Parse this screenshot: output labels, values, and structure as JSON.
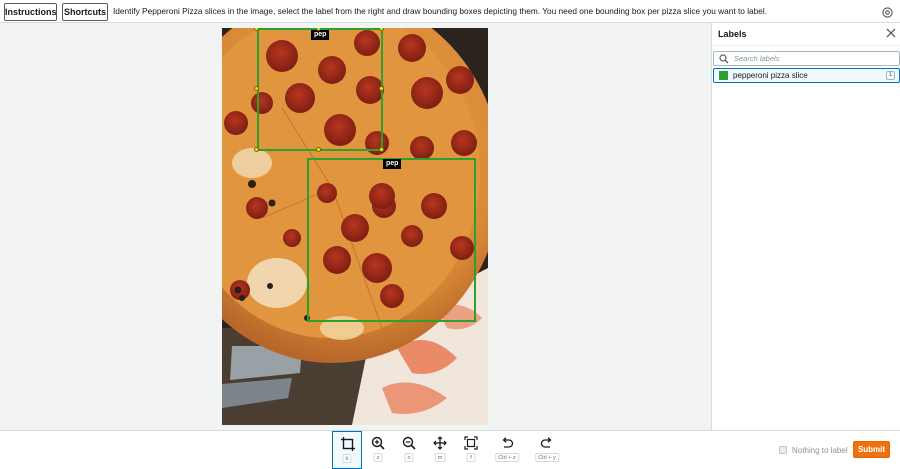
{
  "topbar": {
    "instructions_label": "Instructions",
    "shortcuts_label": "Shortcuts",
    "task_text": "Identify Pepperoni Pizza slices in the image, select the label from the right and draw bounding boxes depicting them. You need one bounding box per pizza slice you want to label.",
    "help_icon": "help-circle-icon"
  },
  "canvas": {
    "image_subject": "pepperoni pizza on cardboard box",
    "annotations": [
      {
        "label": "pep",
        "selected": true
      },
      {
        "label": "pep",
        "selected": false
      }
    ],
    "box_color": "#2ea02e",
    "handle_color": "#f5e40a"
  },
  "labels_panel": {
    "title": "Labels",
    "close_icon": "close-icon",
    "search_placeholder": "Search labels",
    "items": [
      {
        "label": "pepperoni pizza slice",
        "color": "#2ea02e",
        "shortcut": "1"
      }
    ]
  },
  "toolbar": {
    "tools": [
      {
        "name": "box-tool",
        "icon": "bounding-box-icon",
        "shortcut": "b",
        "active": true
      },
      {
        "name": "zoom-in",
        "icon": "zoom-in-icon",
        "shortcut": "z",
        "active": false
      },
      {
        "name": "zoom-out",
        "icon": "zoom-out-icon",
        "shortcut": "o",
        "active": false
      },
      {
        "name": "move",
        "icon": "move-icon",
        "shortcut": "m",
        "active": false
      },
      {
        "name": "fit",
        "icon": "fit-image-icon",
        "shortcut": "f",
        "active": false
      },
      {
        "name": "undo",
        "icon": "undo-icon",
        "shortcut": "Ctrl + z",
        "active": false
      },
      {
        "name": "redo",
        "icon": "redo-icon",
        "shortcut": "Ctrl + y",
        "active": false
      }
    ],
    "nothing_to_label": "Nothing to label",
    "nothing_checked": false,
    "submit_label": "Submit",
    "accent_color": "#ec7211"
  }
}
